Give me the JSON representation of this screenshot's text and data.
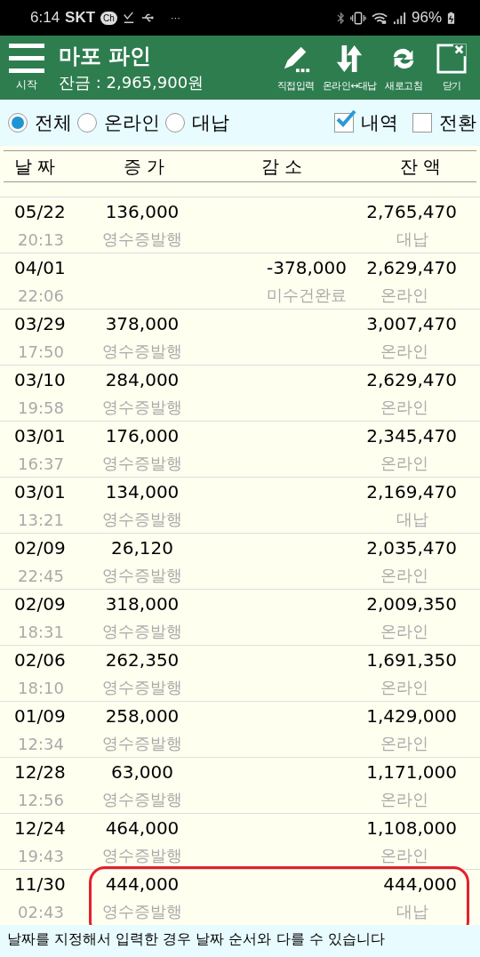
{
  "status_bar": {
    "time": "6:14",
    "carrier": "SKT",
    "chat_badge": "Ch",
    "more": "···",
    "battery": "96%"
  },
  "header": {
    "menu_label": "시작",
    "title": "마포 파인",
    "balance": "잔금 : 2,965,900원",
    "actions": [
      {
        "kind": "pencil",
        "label": "직접입력"
      },
      {
        "kind": "swap",
        "label": "온라인↔대납"
      },
      {
        "kind": "refresh",
        "label": "새로고침"
      },
      {
        "kind": "close",
        "label": "닫기"
      }
    ]
  },
  "filters": [
    {
      "kind": "radio",
      "label": "전체",
      "selected": true
    },
    {
      "kind": "radio",
      "label": "온라인",
      "selected": false
    },
    {
      "kind": "radio",
      "label": "대납",
      "selected": false
    },
    {
      "kind": "checkbox",
      "label": "내역",
      "checked": true
    },
    {
      "kind": "checkbox",
      "label": "전환",
      "checked": false
    }
  ],
  "table": {
    "columns": [
      "날 짜",
      "증 가",
      "감 소",
      "잔 액"
    ],
    "rows": [
      {
        "date": "05/22",
        "time": "20:13",
        "increase": "136,000",
        "increase_note": "영수증발행",
        "balance": "2,765,470",
        "channel": "대납",
        "highlighted": false
      },
      {
        "date": "04/01",
        "time": "22:06",
        "decrease": "-378,000",
        "decrease_note": "미수건완료",
        "balance": "2,629,470",
        "channel": "온라인",
        "highlighted": false
      },
      {
        "date": "03/29",
        "time": "17:50",
        "increase": "378,000",
        "increase_note": "영수증발행",
        "balance": "3,007,470",
        "channel": "온라인",
        "highlighted": false
      },
      {
        "date": "03/10",
        "time": "19:58",
        "increase": "284,000",
        "increase_note": "영수증발행",
        "balance": "2,629,470",
        "channel": "온라인",
        "highlighted": false
      },
      {
        "date": "03/01",
        "time": "16:37",
        "increase": "176,000",
        "increase_note": "영수증발행",
        "balance": "2,345,470",
        "channel": "온라인",
        "highlighted": false
      },
      {
        "date": "03/01",
        "time": "13:21",
        "increase": "134,000",
        "increase_note": "영수증발행",
        "balance": "2,169,470",
        "channel": "대납",
        "highlighted": false
      },
      {
        "date": "02/09",
        "time": "22:45",
        "increase": "26,120",
        "increase_note": "영수증발행",
        "balance": "2,035,470",
        "channel": "온라인",
        "highlighted": false
      },
      {
        "date": "02/09",
        "time": "18:31",
        "increase": "318,000",
        "increase_note": "영수증발행",
        "balance": "2,009,350",
        "channel": "온라인",
        "highlighted": false
      },
      {
        "date": "02/06",
        "time": "18:10",
        "increase": "262,350",
        "increase_note": "영수증발행",
        "balance": "1,691,350",
        "channel": "온라인",
        "highlighted": false
      },
      {
        "date": "01/09",
        "time": "12:34",
        "increase": "258,000",
        "increase_note": "영수증발행",
        "balance": "1,429,000",
        "channel": "온라인",
        "highlighted": false
      },
      {
        "date": "12/28",
        "time": "12:56",
        "increase": "63,000",
        "increase_note": "영수증발행",
        "balance": "1,171,000",
        "channel": "온라인",
        "highlighted": false
      },
      {
        "date": "12/24",
        "time": "19:43",
        "increase": "464,000",
        "increase_note": "영수증발행",
        "balance": "1,108,000",
        "channel": "온라인",
        "highlighted": false
      },
      {
        "date": "11/30",
        "time": "02:43",
        "increase": "444,000",
        "increase_note": "영수증발행",
        "balance": "444,000",
        "channel": "대납",
        "highlighted": true
      }
    ]
  },
  "footer_note": "날짜를 지정해서 입력한 경우 날짜 순서와 다를 수 있습니다"
}
